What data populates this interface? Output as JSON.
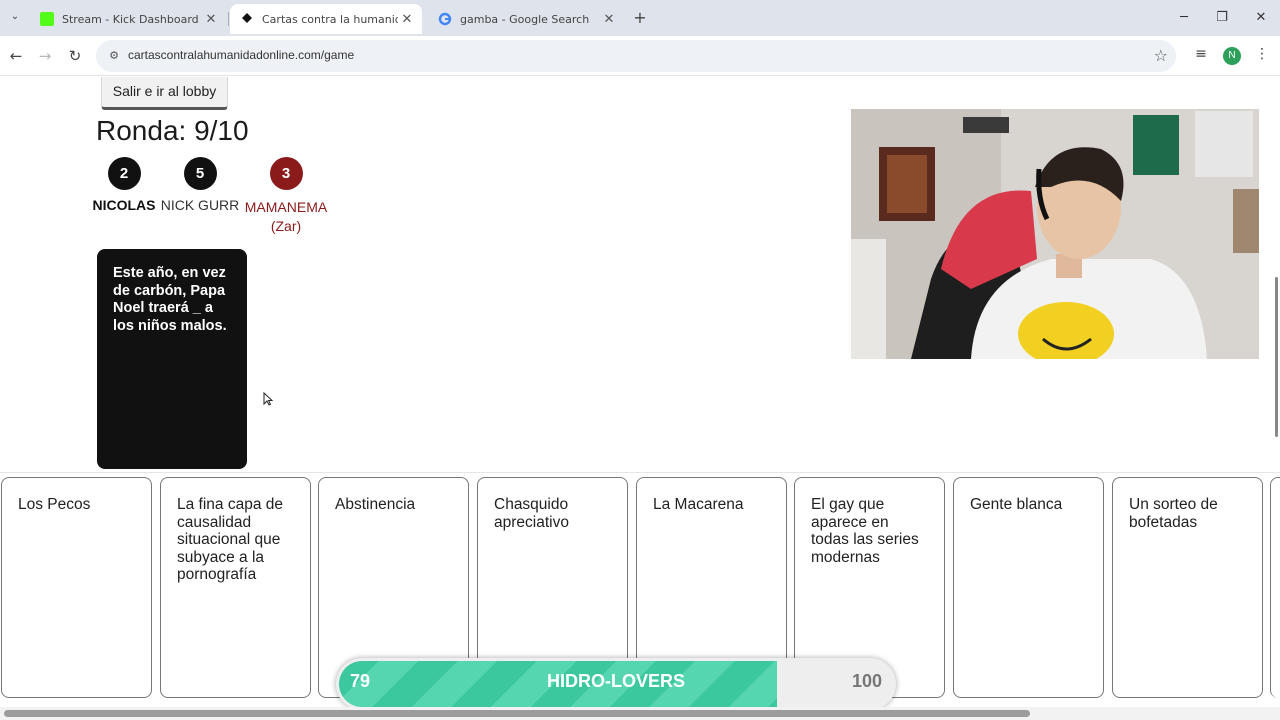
{
  "browser": {
    "tabs": [
      {
        "title": "Stream - Kick Dashboard",
        "favicon": "kick-icon",
        "color": "#53fc18"
      },
      {
        "title": "Cartas contra la humanidad online",
        "favicon": "cards-icon",
        "color": "#111111"
      },
      {
        "title": "gamba - Google Search",
        "favicon": "google-icon",
        "color": "#4285f4"
      }
    ],
    "url": "cartascontralahumanidadonline.com/game",
    "profile_initial": "N"
  },
  "game": {
    "exit_button": "Salir e ir al lobby",
    "round_label": "Ronda: 9/10",
    "players": [
      {
        "score": "2",
        "name": "NICOLAS"
      },
      {
        "score": "5",
        "name": "NICK GURR"
      },
      {
        "score": "3",
        "name": "MAMANEMA",
        "role": "(Zar)"
      }
    ],
    "black_card": "Este año, en vez de carbón, Papa Noel traerá _ a los niños malos.",
    "white_cards": [
      "Los Pecos",
      "La fina capa de causalidad situacional que subyace a la pornografía",
      "Abstinencia",
      "Chasquido apreciativo",
      "La Macarena",
      "El gay que aparece en todas las series modernas",
      "Gente blanca",
      "Un sorteo de bofetadas"
    ]
  },
  "overlay": {
    "current": "79",
    "label": "HIDRO-LOVERS",
    "goal": "100",
    "fraction": 0.79,
    "color": "#3cc89e"
  }
}
